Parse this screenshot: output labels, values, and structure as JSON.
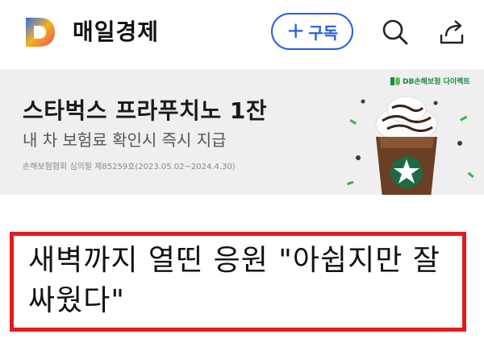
{
  "header": {
    "brand_name": "매일경제",
    "subscribe_label": "구독",
    "subscribe_plus": "+",
    "accent_color": "#2b5ce0"
  },
  "ad": {
    "headline": "스타벅스 프라푸치노 1잔",
    "subline": "내 차 보험료 확인시 즉시 지급",
    "fine_print": "손해보험협회 심의필 제85259호(2023.05.02~2024.4.30)",
    "brand_badge": "DB손해보험 다이렉트",
    "background_color": "#efefef"
  },
  "article": {
    "headline": "새벽까지 열띤 응원 \"아쉽지만 잘 싸웠다\"",
    "highlight_color": "#e31b1b"
  },
  "icons": {
    "logo": "maeil-logo-icon",
    "search": "search-icon",
    "share": "share-icon"
  }
}
